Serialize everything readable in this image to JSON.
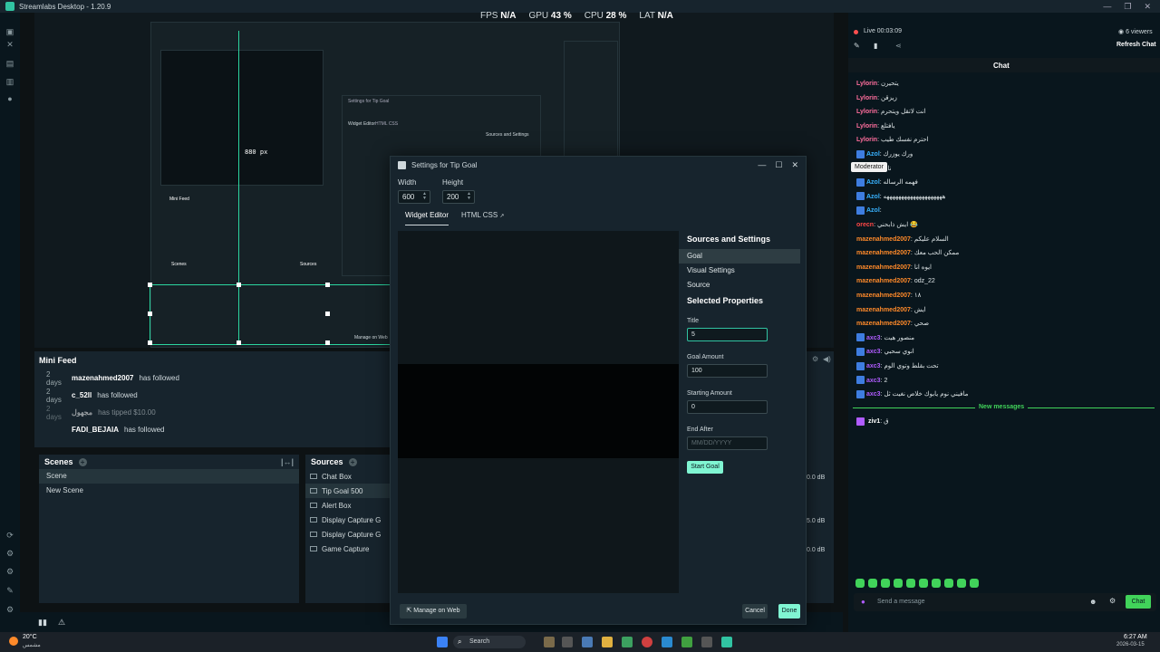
{
  "window": {
    "title": "Streamlabs Desktop - 1.20.9",
    "controls": [
      "—",
      "❐",
      "✕"
    ]
  },
  "perf": {
    "fps_label": "FPS",
    "fps_value": "N/A",
    "gpu_label": "GPU",
    "gpu_value": "43 %",
    "cpu_label": "CPU",
    "cpu_value": "28 %",
    "lat_label": "LAT",
    "lat_value": "N/A"
  },
  "preview": {
    "size_readout": "880 px",
    "nested_dialog_title": "Settings for Tip Goal",
    "nested_tab": "Widget Editor",
    "nested_tab2": "HTML CSS",
    "nested_panel_title": "Sources and Settings",
    "nested_mini_feed": "Mini Feed",
    "nested_scenes": "Scenes",
    "nested_sources": "Sources",
    "nested_manage": "Manage on Web"
  },
  "mini_feed": {
    "title": "Mini Feed",
    "rows": [
      {
        "time": "2 days",
        "user": "mazenahmed2007",
        "action": "has followed"
      },
      {
        "time": "2 days",
        "user": "c_52ll",
        "action": "has followed"
      },
      {
        "time": "2 days",
        "user": "مجهول",
        "action": "has tipped $10.00"
      },
      {
        "time": "",
        "user": "FADI_BEJAIA",
        "action": "has followed"
      }
    ]
  },
  "scenes": {
    "title": "Scenes",
    "items": [
      "Scene",
      "New Scene"
    ]
  },
  "sources": {
    "title": "Sources",
    "items": [
      "Chat Box",
      "Tip Goal 500",
      "Alert Box",
      "Display Capture G",
      "Display Capture G",
      "Game Capture"
    ]
  },
  "mixer": {
    "db": [
      "0.0 dB",
      "5.0 dB",
      "0.0 dB"
    ]
  },
  "dialog": {
    "title": "Settings for Tip Goal",
    "width_label": "Width",
    "width_value": "600",
    "height_label": "Height",
    "height_value": "200",
    "tab_widget_editor": "Widget Editor",
    "tab_html_css": "HTML CSS",
    "sources_header": "Sources and Settings",
    "side_items": [
      "Goal",
      "Visual Settings",
      "Source"
    ],
    "selected_header": "Selected Properties",
    "title_label": "Title",
    "title_value": "5",
    "goal_amount_label": "Goal Amount",
    "goal_amount_value": "100",
    "starting_amount_label": "Starting Amount",
    "starting_amount_value": "0",
    "end_after_label": "End After",
    "end_after_placeholder": "MM/DD/YYYY",
    "start_goal": "Start Goal",
    "manage_on_web": "Manage on Web",
    "cancel": "Cancel",
    "done": "Done"
  },
  "chat_panel": {
    "live_label": "Live 00:03:09",
    "viewers": "6 viewers",
    "refresh": "Refresh Chat",
    "chat_title": "Chat",
    "moderator_tooltip": "Moderator",
    "new_messages": "New messages",
    "send_placeholder": "Send a message",
    "chat_button": "Chat",
    "messages": [
      {
        "user": "Lylorin",
        "text": "يتحيرن",
        "color": "pink",
        "badge": false
      },
      {
        "user": "Lylorin",
        "text": "زيزقن",
        "color": "pink",
        "badge": false
      },
      {
        "user": "Lylorin",
        "text": "انت لاتقل ويتحرم",
        "color": "pink",
        "badge": false
      },
      {
        "user": "Lylorin",
        "text": "يافتلع",
        "color": "pink",
        "badge": false
      },
      {
        "user": "Lylorin",
        "text": "احترم نفسك طيب",
        "color": "pink",
        "badge": false
      },
      {
        "user": "Azol",
        "text": "ورك يوزرك",
        "color": "blue",
        "badge": true
      },
      {
        "user": "",
        "text": "نا فيم ي",
        "color": "blue",
        "badge": true
      },
      {
        "user": "Azol",
        "text": "فهمه الرساله",
        "color": "blue",
        "badge": true
      },
      {
        "user": "Azol",
        "text": "ههههههههههههههههههههه",
        "color": "blue",
        "badge": true
      },
      {
        "user": "Azol",
        "text": "",
        "color": "blue",
        "badge": true
      },
      {
        "user": "orecn",
        "text": "ايش ذابحني 😂",
        "color": "red",
        "badge": false
      },
      {
        "user": "mazenahmed2007",
        "text": "السلام عليكم",
        "color": "orange",
        "badge": false
      },
      {
        "user": "mazenahmed2007",
        "text": "ممكن الحب معك",
        "color": "orange",
        "badge": false
      },
      {
        "user": "mazenahmed2007",
        "text": "ايوه انا",
        "color": "orange",
        "badge": false
      },
      {
        "user": "mazenahmed2007",
        "text": "odz_22",
        "color": "orange",
        "badge": false
      },
      {
        "user": "mazenahmed2007",
        "text": "١٨",
        "color": "orange",
        "badge": false
      },
      {
        "user": "mazenahmed2007",
        "text": "ايش",
        "color": "orange",
        "badge": false
      },
      {
        "user": "mazenahmed2007",
        "text": "صحي",
        "color": "orange",
        "badge": false
      },
      {
        "user": "axc3",
        "text": "منصور هيت",
        "color": "violet",
        "badge": true
      },
      {
        "user": "axc3",
        "text": "انوي سحبي",
        "color": "violet",
        "badge": true
      },
      {
        "user": "axc3",
        "text": "تحت بقلط وتوي الوم",
        "color": "violet",
        "badge": true
      },
      {
        "user": "axc3",
        "text": "2",
        "color": "violet",
        "badge": true
      },
      {
        "user": "axc3",
        "text": "مافيني نوم يابوك خلاص نغيت ثل",
        "color": "violet",
        "badge": true
      }
    ],
    "after_new": {
      "user": "ziv1",
      "text": "ق"
    }
  },
  "taskbar": {
    "weather": "20°C",
    "weather_sub": "مشمس",
    "search": "Search",
    "time": "6:27 AM",
    "date": "2026-03-15"
  },
  "colors": {
    "accent": "#31c3a2",
    "panel": "#17242d",
    "background": "#09161d"
  }
}
